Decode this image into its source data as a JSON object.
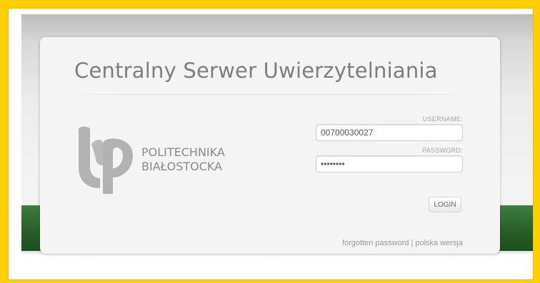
{
  "page": {
    "title": "Centralny Serwer Uwierzytelniania"
  },
  "logo": {
    "line1": "POLITECHNIKA",
    "line2": "BIAŁOSTOCKA"
  },
  "form": {
    "username_label": "USERNAME:",
    "username_value": "00700030027",
    "password_label": "PASSWORD:",
    "password_value": "••••••••",
    "login_label": "LOGIN"
  },
  "footer": {
    "forgotten_password": "forgotten password",
    "separator": "|",
    "language_switch": "polska wersja"
  },
  "colors": {
    "frame_border": "#ffd000",
    "accent_green": "#2a612c",
    "title_gray": "#7e7e7e"
  }
}
